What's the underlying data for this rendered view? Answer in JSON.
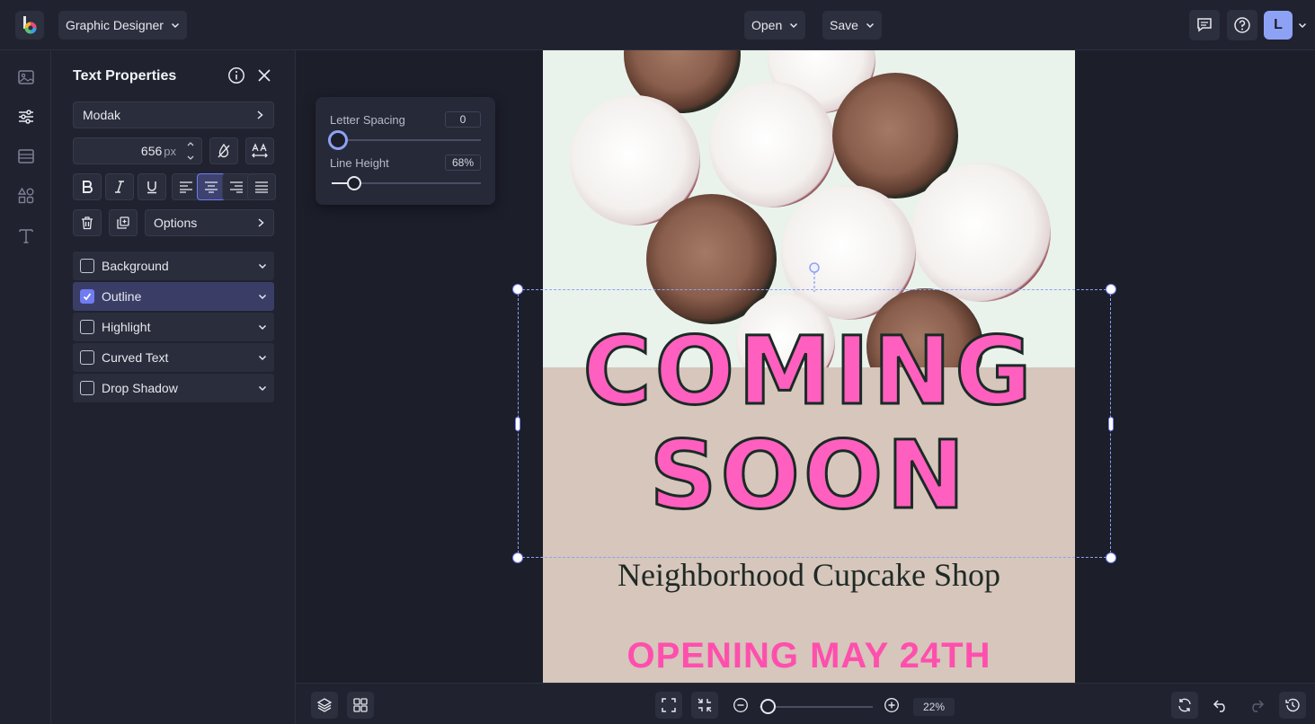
{
  "header": {
    "app_menu_label": "Graphic Designer",
    "open_label": "Open",
    "save_label": "Save",
    "user_initial": "L"
  },
  "panel": {
    "title": "Text Properties",
    "font_name": "Modak",
    "font_size": "656",
    "font_size_unit": "px",
    "options_label": "Options",
    "sections": [
      {
        "label": "Background",
        "checked": false
      },
      {
        "label": "Outline",
        "checked": true
      },
      {
        "label": "Highlight",
        "checked": false
      },
      {
        "label": "Curved Text",
        "checked": false
      },
      {
        "label": "Drop Shadow",
        "checked": false
      }
    ]
  },
  "spacing": {
    "letter_label": "Letter Spacing",
    "letter_value": "0",
    "line_label": "Line Height",
    "line_value": "68%"
  },
  "poster": {
    "headline_1": "COMING",
    "headline_2": "SOON",
    "shop_name": "Neighborhood Cupcake Shop",
    "opening": "OPENING MAY 24TH"
  },
  "footer": {
    "zoom": "22%"
  },
  "colors": {
    "accent": "#6f7cf2",
    "headline": "#ff5fbf",
    "avatar": "#8ea2f5"
  }
}
